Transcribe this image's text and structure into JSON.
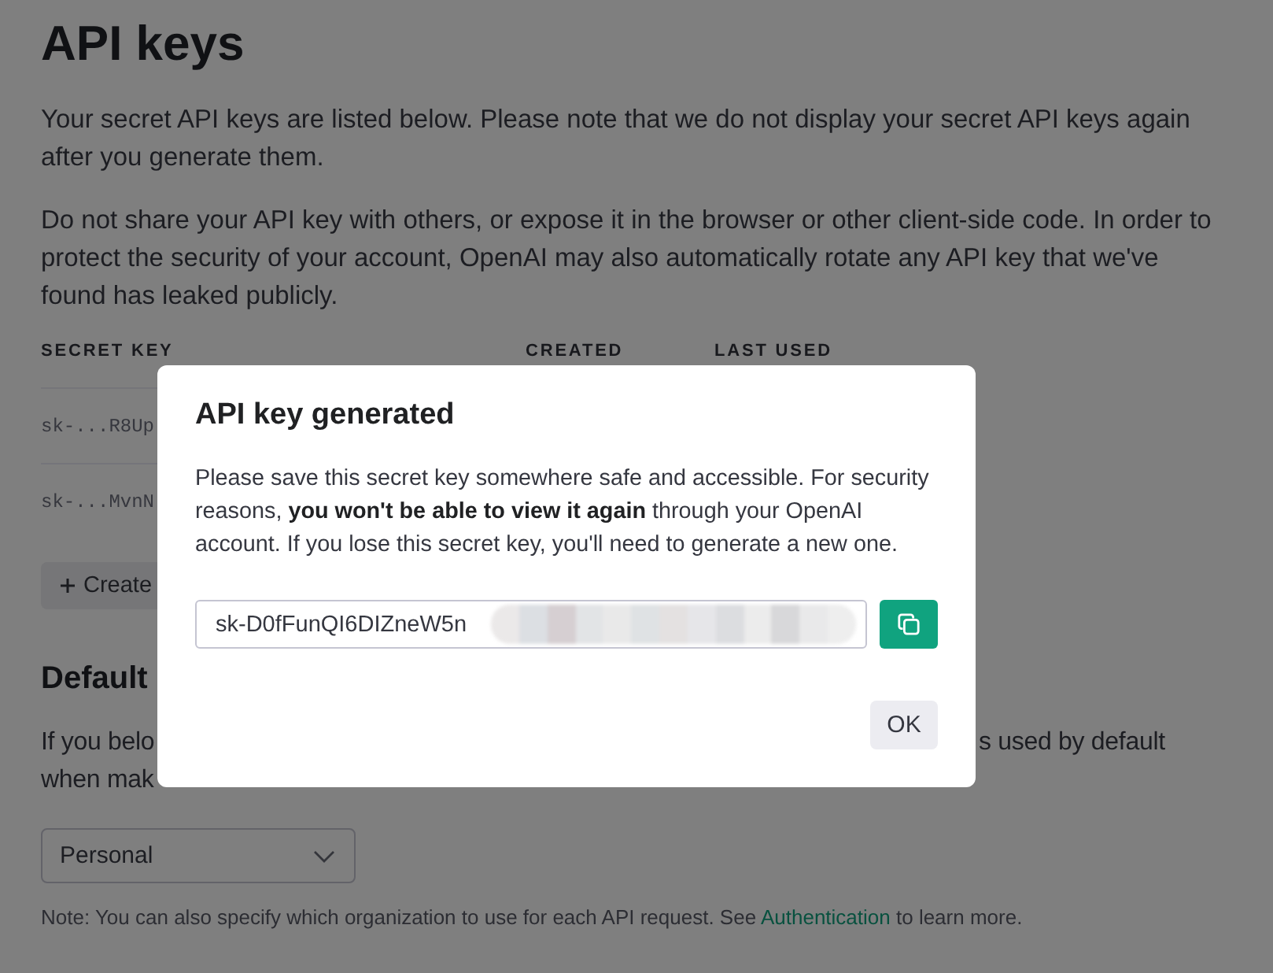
{
  "page": {
    "title": "API keys",
    "paragraphs": [
      "Your secret API keys are listed below. Please note that we do not display your secret API keys again after you generate them.",
      "Do not share your API key with others, or expose it in the browser or other client-side code. In order to protect the security of your account, OpenAI may also automatically rotate any API key that we've found has leaked publicly."
    ]
  },
  "keys_table": {
    "columns": [
      "SECRET KEY",
      "CREATED",
      "LAST USED"
    ],
    "rows": [
      {
        "secret_key": "sk-...R8Up"
      },
      {
        "secret_key": "sk-...MvnN"
      }
    ]
  },
  "create_button": {
    "label": "Create"
  },
  "default_organization": {
    "heading": "Default",
    "description_lines": [
      {
        "before_dialog": "If you belo",
        "after_dialog": "s used by default"
      },
      {
        "before_dialog": "when mak"
      }
    ],
    "select": {
      "value": "Personal"
    }
  },
  "note": {
    "before_link": "Note: You can also specify which organization to use for each API request. See ",
    "link": "Authentication",
    "after_link": " to learn more."
  },
  "dialog": {
    "title": "API key generated",
    "message": "Please save this secret key somewhere safe and accessible. For security reasons, **you won't be able to view it again** through your OpenAI account. If you lose this secret key, you'll need to generate a new one.",
    "key_field": {
      "value": "sk-D0fFunQI6DIZneW5n",
      "redacted": true
    },
    "ok_button": {
      "label": "OK"
    }
  }
}
